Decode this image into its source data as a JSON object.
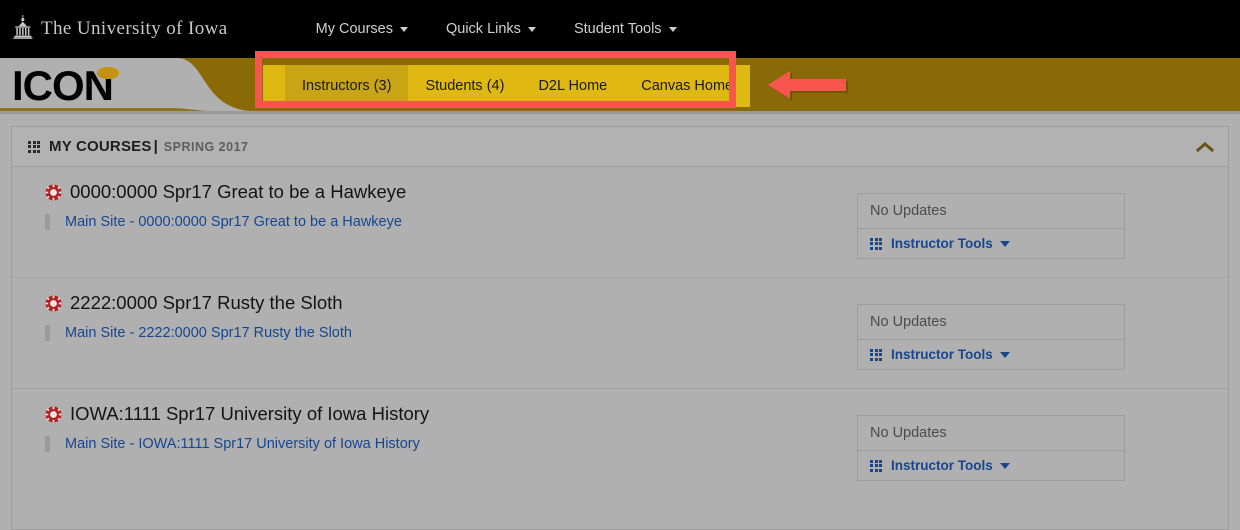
{
  "topbar": {
    "brand": "The University of Iowa",
    "brand_icon": "capitol-building-icon",
    "nav": [
      {
        "label": "My Courses",
        "icon": "chevron-down-icon"
      },
      {
        "label": "Quick Links",
        "icon": "chevron-down-icon"
      },
      {
        "label": "Student Tools",
        "icon": "chevron-down-icon"
      }
    ]
  },
  "iconbar": {
    "logo": "ICON",
    "tabs": [
      {
        "label": "Instructors (3)",
        "active": true
      },
      {
        "label": "Students (4)",
        "active": false
      },
      {
        "label": "D2L Home",
        "active": false
      },
      {
        "label": "Canvas Home",
        "active": false
      }
    ]
  },
  "annotations": {
    "highlight_color": "#f8554f",
    "arrow_direction": "left",
    "arrow_icon": "left-arrow-annotation-icon"
  },
  "card": {
    "header": {
      "icon": "grid-icon",
      "title": "MY COURSES",
      "separator": "|",
      "term": "SPRING 2017",
      "collapse_icon": "chevron-up-icon"
    },
    "courses": [
      {
        "icon": "course-badge-icon",
        "title": "0000:0000 Spr17 Great to be a Hawkeye",
        "link": "Main Site - 0000:0000 Spr17 Great to be a Hawkeye",
        "updates_status": "No Updates",
        "tools_label": "Instructor Tools",
        "tools_icon": "grid-icon",
        "tools_caret": "caret-down-icon"
      },
      {
        "icon": "course-badge-icon",
        "title": "2222:0000 Spr17 Rusty the Sloth",
        "link": "Main Site - 2222:0000 Spr17 Rusty the Sloth",
        "updates_status": "No Updates",
        "tools_label": "Instructor Tools",
        "tools_icon": "grid-icon",
        "tools_caret": "caret-down-icon"
      },
      {
        "icon": "course-badge-icon",
        "title": "IOWA:1111 Spr17 University of Iowa History",
        "link": "Main Site - IOWA:1111 Spr17 University of Iowa History",
        "updates_status": "No Updates",
        "tools_label": "Instructor Tools",
        "tools_icon": "grid-icon",
        "tools_caret": "caret-down-icon"
      }
    ]
  },
  "colors": {
    "topbar_bg": "#000000",
    "gold_bar": "#8a6a06",
    "tab_gold": "#e0b812",
    "tab_active_gold": "#c9a515",
    "link_blue": "#17468f",
    "course_badge_red": "#b32020",
    "page_bg": "#b0b0b0"
  }
}
